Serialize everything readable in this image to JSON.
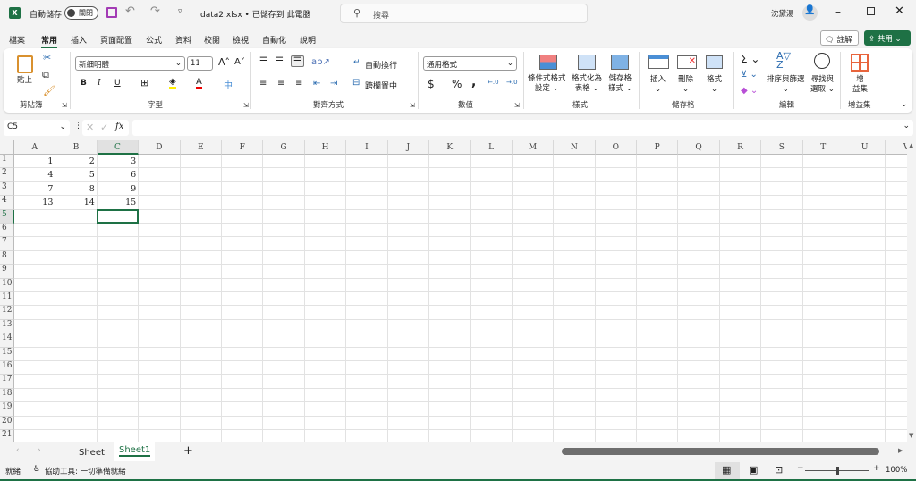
{
  "titlebar": {
    "autosave_label": "自動儲存",
    "autosave_state": "關閉",
    "filename": "data2.xlsx • 已儲存到 此電腦",
    "search_placeholder": "搜尋",
    "user_name": "沈黛湯"
  },
  "menu_tabs": [
    "檔案",
    "常用",
    "插入",
    "頁面配置",
    "公式",
    "資料",
    "校閱",
    "檢視",
    "自動化",
    "說明"
  ],
  "active_tab": "常用",
  "header_buttons": {
    "comments": "註解",
    "share": "共用"
  },
  "ribbon": {
    "clipboard": {
      "paste": "貼上",
      "group": "剪貼簿"
    },
    "font": {
      "font_name": "新細明體",
      "font_size": "11",
      "bold": "B",
      "italic": "I",
      "underline": "U",
      "group": "字型"
    },
    "alignment": {
      "wrap_text": "自動換行",
      "merge_center": "跨欄置中",
      "group": "對齊方式"
    },
    "number": {
      "format": "通用格式",
      "currency": "$",
      "percent": "%",
      "comma": ",",
      "group": "數值"
    },
    "styles": {
      "conditional": [
        "條件式格式",
        "設定"
      ],
      "format_table": [
        "格式化為",
        "表格"
      ],
      "cell_styles": [
        "儲存格",
        "樣式"
      ],
      "group": "樣式"
    },
    "cells": {
      "insert": "插入",
      "delete": "刪除",
      "format": "格式",
      "group": "儲存格"
    },
    "editing": {
      "sort_filter": "排序與篩選",
      "find_select": [
        "尋找與",
        "選取"
      ],
      "group": "編輯"
    },
    "addins": {
      "label": [
        "增",
        "益集"
      ],
      "group": "增益集"
    }
  },
  "formula_bar": {
    "name_box": "C5",
    "fx": "fx",
    "value": ""
  },
  "sheet": {
    "columns": [
      "A",
      "B",
      "C",
      "D",
      "E",
      "F",
      "G",
      "H",
      "I",
      "J",
      "K",
      "L",
      "M",
      "N",
      "O",
      "P",
      "Q",
      "R",
      "S",
      "T",
      "U",
      "V"
    ],
    "row_count": 21,
    "selected_cell": "C5",
    "cells": [
      [
        "1",
        "2",
        "3"
      ],
      [
        "4",
        "5",
        "6"
      ],
      [
        "7",
        "8",
        "9"
      ],
      [
        "13",
        "14",
        "15"
      ]
    ]
  },
  "sheet_tabs": [
    "Sheet",
    "Sheet1"
  ],
  "active_sheet": "Sheet1",
  "status": {
    "ready": "就緒",
    "accessibility": "協助工具: 一切準備就緒",
    "zoom": "100%",
    "zoom_level": 100
  },
  "colors": {
    "accent": "#1e7145",
    "share_button": "#1e7145"
  }
}
